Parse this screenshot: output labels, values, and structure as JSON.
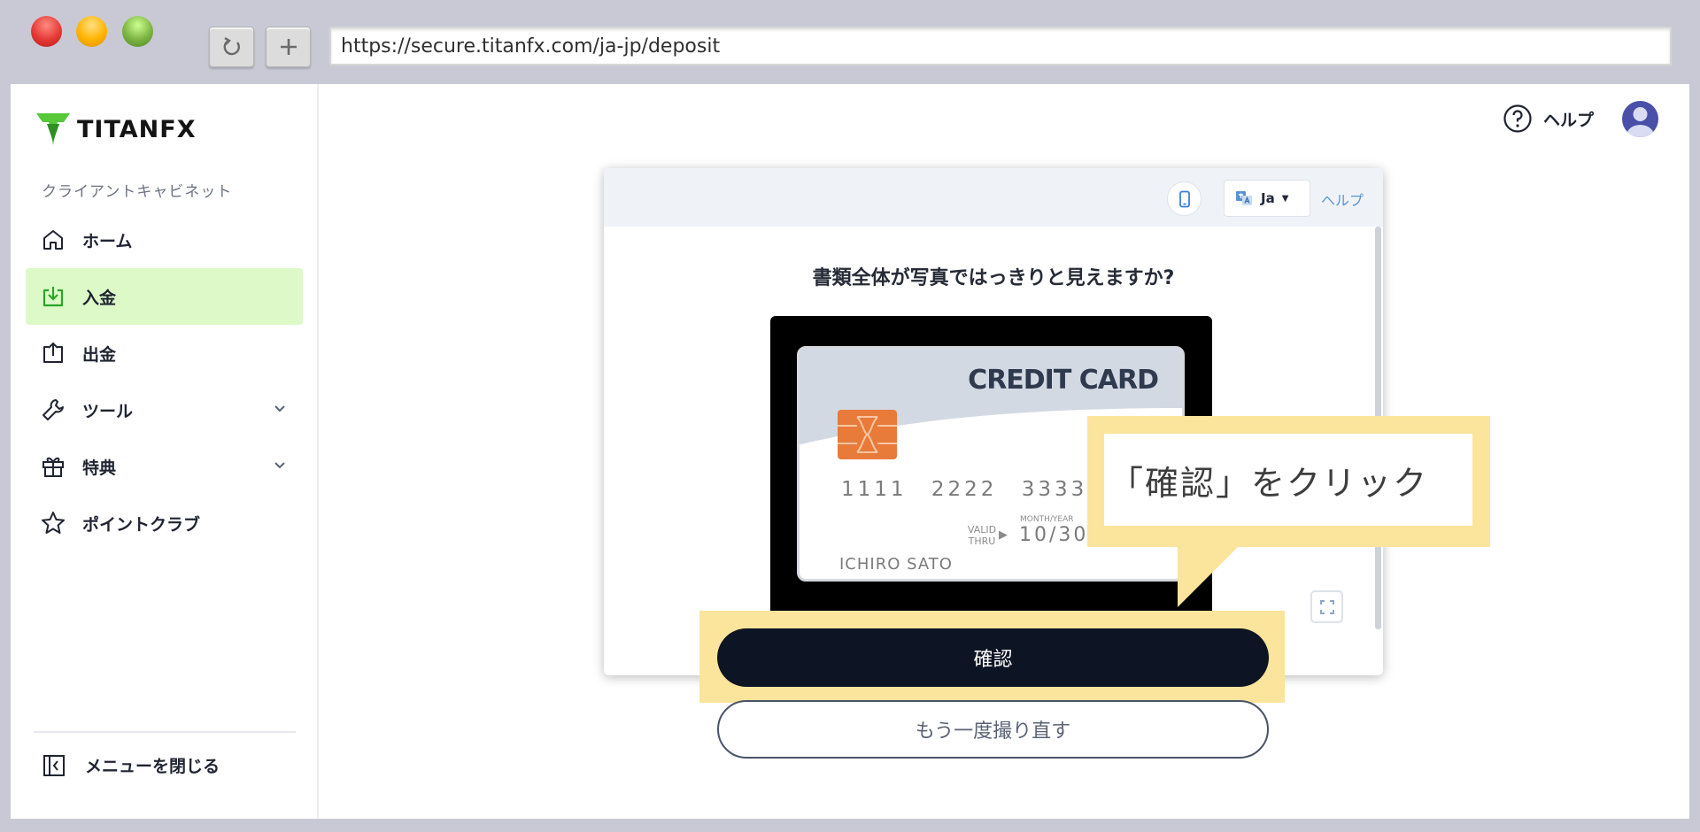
{
  "browser": {
    "url": "https://secure.titanfx.com/ja-jp/deposit"
  },
  "brand": {
    "name": "TITANFX",
    "accent": "#56c83a"
  },
  "sidebar": {
    "section_label": "クライアントキャビネット",
    "items": [
      {
        "label": "ホーム",
        "icon": "home-icon",
        "active": false
      },
      {
        "label": "入金",
        "icon": "deposit-icon",
        "active": true
      },
      {
        "label": "出金",
        "icon": "withdraw-icon",
        "active": false
      },
      {
        "label": "ツール",
        "icon": "wrench-icon",
        "active": false,
        "expandable": true
      },
      {
        "label": "特典",
        "icon": "gift-icon",
        "active": false,
        "expandable": true
      },
      {
        "label": "ポイントクラブ",
        "icon": "star-icon",
        "active": false
      }
    ],
    "close_menu_label": "メニューを閉じる"
  },
  "header": {
    "help_label": "ヘルプ"
  },
  "modal": {
    "language": "Ja",
    "help_label": "ヘルプ",
    "title": "書類全体が写真ではっきりと見えますか?",
    "card": {
      "title": "CREDIT CARD",
      "number": "1111 2222 3333",
      "valid_thru": "VALID THRU",
      "month_year": "MONTH/YEAR",
      "expiry": "10/30",
      "holder": "ICHIRO SATO"
    },
    "confirm_label": "確認",
    "retake_label": "もう一度撮り直す"
  },
  "callout": {
    "text": "「確認」をクリック",
    "color": "#fbe49b"
  }
}
